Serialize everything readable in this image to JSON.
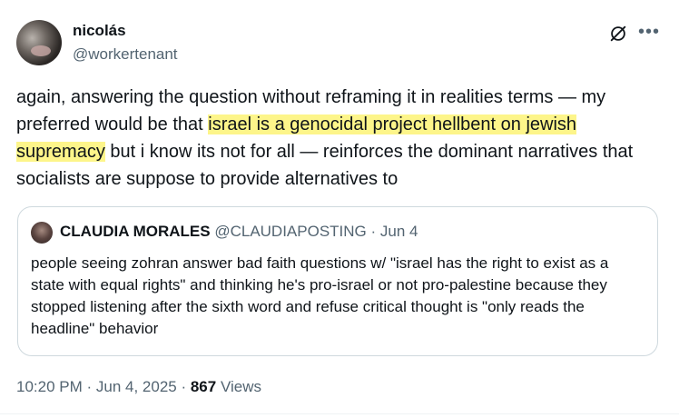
{
  "author": {
    "display_name": "nicolás",
    "handle": "@workertenant"
  },
  "tweet": {
    "text_before": "again, answering the question without reframing it in realities terms — my preferred would be that ",
    "highlighted": "israel is a genocidal project hellbent on jewish supremacy",
    "text_after": " but i know its not for all — reinforces the dominant narratives that socialists are suppose to provide alternatives to"
  },
  "quote": {
    "display_name": "CLAUDIA MORALES",
    "handle": "@CLAUDIAPOSTING",
    "separator": " · ",
    "date": "Jun 4",
    "text": "people seeing zohran answer bad faith questions w/ \"israel has the right to exist as a state with equal rights\" and thinking he's pro-israel or not pro-palestine because they stopped listening after the sixth word and refuse critical thought is \"only reads the headline\" behavior"
  },
  "meta": {
    "time": "10:20 PM",
    "separator": " · ",
    "date": "Jun 4, 2025",
    "views_count": "867",
    "views_label": " Views"
  },
  "icons": {
    "grok": "grok-icon",
    "more": "more-options-icon"
  },
  "colors": {
    "highlight": "#fdf58a",
    "secondary_text": "#536471",
    "border": "#cfd9de"
  }
}
